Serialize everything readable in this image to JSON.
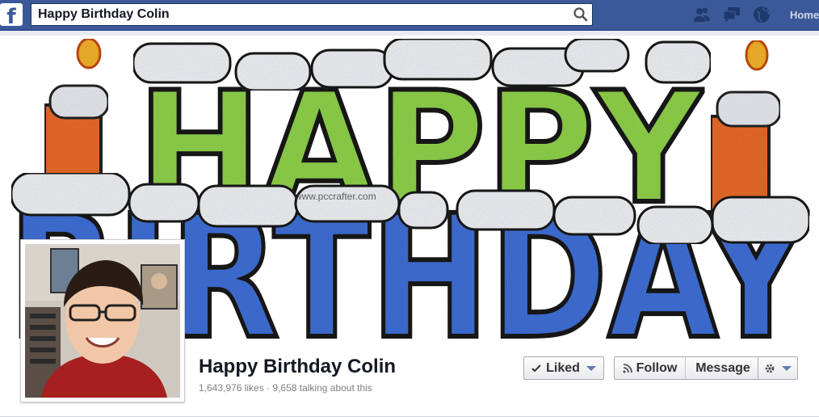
{
  "topbar": {
    "search_value": "Happy Birthday Colin",
    "home_label": "Home",
    "icons": [
      "facebook-logo",
      "search-icon",
      "friend-requests-icon",
      "messages-icon",
      "notifications-globe-icon"
    ],
    "brand_color": "#3b5998"
  },
  "cover": {
    "watermark": "www.pccrafter.com",
    "banner_letters": "HAPPY BIRTHDAY"
  },
  "page": {
    "name": "Happy Birthday Colin",
    "stats": "1,643,976 likes · 9,658 talking about this"
  },
  "actions": {
    "liked_label": "Liked",
    "follow_label": "Follow",
    "message_label": "Message",
    "icons": [
      "checkmark-icon",
      "rss-follow-icon",
      "gear-icon",
      "chevron-down-icon"
    ]
  }
}
